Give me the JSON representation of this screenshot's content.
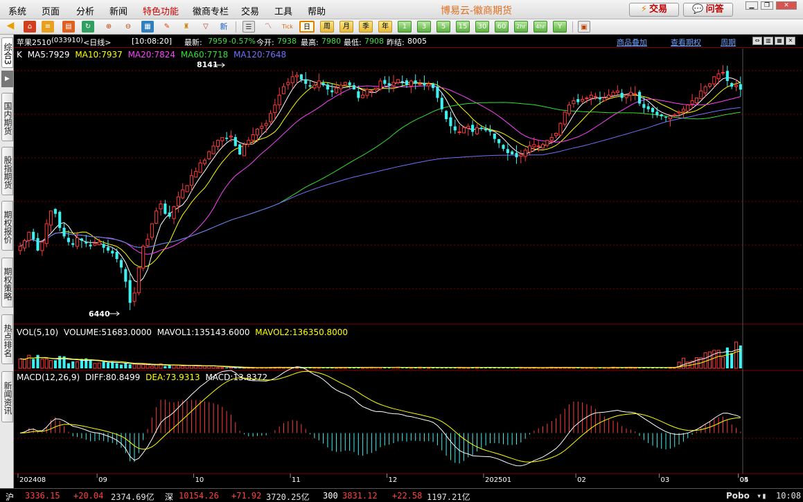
{
  "menubar": {
    "items": [
      "系统",
      "页面",
      "分析",
      "新闻",
      "特色功能",
      "徽商专栏",
      "交易",
      "工具",
      "帮助"
    ],
    "app_title": "博易云-徽商期货",
    "trade_button": "交易",
    "ask_button": "问答"
  },
  "toolbar": {
    "periods": [
      "日",
      "周",
      "月",
      "季",
      "年",
      "1",
      "3",
      "5",
      "15",
      "30",
      "60",
      "2hr",
      "4hr",
      "Y"
    ],
    "active_period": "日"
  },
  "left_tabs": [
    "综合3",
    "国内期货",
    "股指期货",
    "期权报价",
    "期权策略",
    "热点排名",
    "新闻资讯"
  ],
  "info": {
    "contract": "苹果2510",
    "code": "(033910)",
    "period": "<日线>",
    "time": "[10:08:20]",
    "latest_label": "最新:",
    "latest": "7959",
    "change": "-0.57%",
    "open_label": "今开:",
    "open": "7938",
    "high_label": "最高:",
    "high": "7980",
    "low_label": "最低:",
    "low": "7908",
    "prev_label": "昨结:",
    "prev": "8005",
    "links": [
      "商品叠加",
      "查看期权",
      "周期"
    ]
  },
  "ma_legend": {
    "k": "K",
    "ma5": "MA5:7929",
    "ma10": "MA10:7937",
    "ma20": "MA20:7824",
    "ma60": "MA60:7718",
    "ma120": "MA120:7648"
  },
  "vol_legend": {
    "title": "VOL(5,10)",
    "volume": "VOLUME:51683.0000",
    "mavol1": "MAVOL1:135143.6000",
    "mavol2": "MAVOL2:136350.8000"
  },
  "macd_legend": {
    "title": "MACD(12,26,9)",
    "diff": "DIFF:80.8499",
    "dea": "DEA:73.9313",
    "macd": "MACD:13.8372"
  },
  "price_annotations": {
    "high": "8141",
    "low": "6440"
  },
  "x_axis": [
    "202408",
    "09",
    "10",
    "11",
    "12",
    "202501",
    "02",
    "03",
    "04",
    "05"
  ],
  "colors": {
    "up": "#ff3b3b",
    "down": "#3ff0f0",
    "ma5": "#ffffff",
    "ma10": "#ffff00",
    "ma20": "#ff40ff",
    "ma60": "#30e030",
    "ma120": "#7070ff",
    "grid": "#800000"
  },
  "chart_data": {
    "type": "candlestick",
    "title": "苹果2510 (033910) 日线",
    "price_range": [
      6300,
      8250
    ],
    "price_high_label": 8141,
    "price_low_label": 6440,
    "months": [
      "202408",
      "09",
      "10",
      "11",
      "12",
      "202501",
      "02",
      "03",
      "04",
      "05"
    ],
    "closes": [
      6850,
      6890,
      6950,
      6900,
      6820,
      6880,
      7010,
      7100,
      7080,
      6980,
      6920,
      6880,
      6860,
      6910,
      6890,
      6870,
      6850,
      6870,
      6880,
      6840,
      6820,
      6800,
      6760,
      6700,
      6600,
      6450,
      6520,
      6700,
      6850,
      6900,
      7010,
      7100,
      7150,
      7080,
      7060,
      7130,
      7200,
      7250,
      7280,
      7350,
      7380,
      7440,
      7460,
      7520,
      7560,
      7600,
      7620,
      7610,
      7630,
      7560,
      7500,
      7570,
      7600,
      7640,
      7680,
      7700,
      7720,
      7790,
      7850,
      7920,
      7980,
      8010,
      8050,
      8060,
      8030,
      8000,
      7980,
      7990,
      8020,
      7990,
      7960,
      7940,
      7970,
      7990,
      8010,
      7990,
      7960,
      7900,
      7920,
      7960,
      7950,
      7970,
      8020,
      8000,
      7990,
      8010,
      8030,
      8010,
      7990,
      8020,
      8000,
      8000,
      7990,
      8000,
      7970,
      7900,
      7820,
      7750,
      7700,
      7670,
      7660,
      7690,
      7700,
      7660,
      7690,
      7680,
      7670,
      7660,
      7610,
      7580,
      7540,
      7510,
      7500,
      7480,
      7500,
      7530,
      7560,
      7570,
      7560,
      7570,
      7600,
      7620,
      7650,
      7720,
      7800,
      7850,
      7880,
      7870,
      7890,
      7900,
      7920,
      7910,
      7890,
      7900,
      7920,
      7940,
      7950,
      7900,
      7920,
      7940,
      7930,
      7860,
      7830,
      7820,
      7800,
      7780,
      7770,
      7760,
      7770,
      7780,
      7800,
      7820,
      7850,
      7880,
      7900,
      7950,
      7980,
      8000,
      8050,
      8070,
      8080,
      8020,
      7980,
      7990,
      7959
    ],
    "volume_scale_max": 300000,
    "macd_range": [
      -120,
      160
    ]
  }
}
